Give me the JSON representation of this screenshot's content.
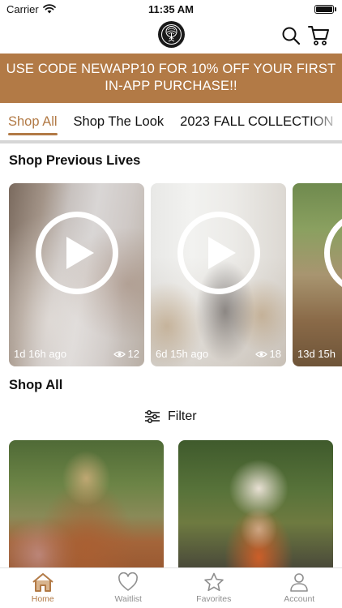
{
  "status_bar": {
    "carrier": "Carrier",
    "time": "11:35 AM",
    "battery_level": 1.0
  },
  "header": {
    "logo_icon": "tree-of-life-logo",
    "search_icon": "search-icon",
    "cart_icon": "cart-icon"
  },
  "promo": {
    "text": "USE CODE NEWAPP10 FOR 10% OFF YOUR FIRST IN-APP PURCHASE!!"
  },
  "tabs": [
    {
      "label": "Shop All",
      "active": true
    },
    {
      "label": "Shop The Look",
      "active": false
    },
    {
      "label": "2023 FALL COLLECTION",
      "active": false
    }
  ],
  "lives_section": {
    "title": "Shop Previous Lives",
    "items": [
      {
        "age": "1d 16h ago",
        "views": "12"
      },
      {
        "age": "6d 15h ago",
        "views": "18"
      },
      {
        "age": "13d 15h",
        "views": ""
      }
    ]
  },
  "shop_all": {
    "title": "Shop All",
    "filter_label": "Filter"
  },
  "tabbar": [
    {
      "label": "Home",
      "icon": "home-icon",
      "active": true
    },
    {
      "label": "Waitlist",
      "icon": "heart-icon",
      "active": false
    },
    {
      "label": "Favorites",
      "icon": "star-icon",
      "active": false
    },
    {
      "label": "Account",
      "icon": "person-icon",
      "active": false
    }
  ],
  "colors": {
    "accent": "#b27a46",
    "inactive": "#8e8e8e"
  }
}
